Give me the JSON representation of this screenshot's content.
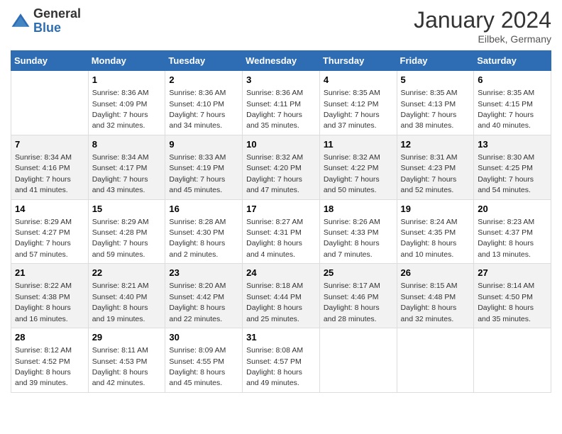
{
  "header": {
    "logo": {
      "general": "General",
      "blue": "Blue"
    },
    "title": "January 2024",
    "location": "Eilbek, Germany"
  },
  "days_header": [
    "Sunday",
    "Monday",
    "Tuesday",
    "Wednesday",
    "Thursday",
    "Friday",
    "Saturday"
  ],
  "weeks": [
    [
      {
        "day": "",
        "sunrise": "",
        "sunset": "",
        "daylight": ""
      },
      {
        "day": "1",
        "sunrise": "Sunrise: 8:36 AM",
        "sunset": "Sunset: 4:09 PM",
        "daylight": "Daylight: 7 hours and 32 minutes."
      },
      {
        "day": "2",
        "sunrise": "Sunrise: 8:36 AM",
        "sunset": "Sunset: 4:10 PM",
        "daylight": "Daylight: 7 hours and 34 minutes."
      },
      {
        "day": "3",
        "sunrise": "Sunrise: 8:36 AM",
        "sunset": "Sunset: 4:11 PM",
        "daylight": "Daylight: 7 hours and 35 minutes."
      },
      {
        "day": "4",
        "sunrise": "Sunrise: 8:35 AM",
        "sunset": "Sunset: 4:12 PM",
        "daylight": "Daylight: 7 hours and 37 minutes."
      },
      {
        "day": "5",
        "sunrise": "Sunrise: 8:35 AM",
        "sunset": "Sunset: 4:13 PM",
        "daylight": "Daylight: 7 hours and 38 minutes."
      },
      {
        "day": "6",
        "sunrise": "Sunrise: 8:35 AM",
        "sunset": "Sunset: 4:15 PM",
        "daylight": "Daylight: 7 hours and 40 minutes."
      }
    ],
    [
      {
        "day": "7",
        "sunrise": "Sunrise: 8:34 AM",
        "sunset": "Sunset: 4:16 PM",
        "daylight": "Daylight: 7 hours and 41 minutes."
      },
      {
        "day": "8",
        "sunrise": "Sunrise: 8:34 AM",
        "sunset": "Sunset: 4:17 PM",
        "daylight": "Daylight: 7 hours and 43 minutes."
      },
      {
        "day": "9",
        "sunrise": "Sunrise: 8:33 AM",
        "sunset": "Sunset: 4:19 PM",
        "daylight": "Daylight: 7 hours and 45 minutes."
      },
      {
        "day": "10",
        "sunrise": "Sunrise: 8:32 AM",
        "sunset": "Sunset: 4:20 PM",
        "daylight": "Daylight: 7 hours and 47 minutes."
      },
      {
        "day": "11",
        "sunrise": "Sunrise: 8:32 AM",
        "sunset": "Sunset: 4:22 PM",
        "daylight": "Daylight: 7 hours and 50 minutes."
      },
      {
        "day": "12",
        "sunrise": "Sunrise: 8:31 AM",
        "sunset": "Sunset: 4:23 PM",
        "daylight": "Daylight: 7 hours and 52 minutes."
      },
      {
        "day": "13",
        "sunrise": "Sunrise: 8:30 AM",
        "sunset": "Sunset: 4:25 PM",
        "daylight": "Daylight: 7 hours and 54 minutes."
      }
    ],
    [
      {
        "day": "14",
        "sunrise": "Sunrise: 8:29 AM",
        "sunset": "Sunset: 4:27 PM",
        "daylight": "Daylight: 7 hours and 57 minutes."
      },
      {
        "day": "15",
        "sunrise": "Sunrise: 8:29 AM",
        "sunset": "Sunset: 4:28 PM",
        "daylight": "Daylight: 7 hours and 59 minutes."
      },
      {
        "day": "16",
        "sunrise": "Sunrise: 8:28 AM",
        "sunset": "Sunset: 4:30 PM",
        "daylight": "Daylight: 8 hours and 2 minutes."
      },
      {
        "day": "17",
        "sunrise": "Sunrise: 8:27 AM",
        "sunset": "Sunset: 4:31 PM",
        "daylight": "Daylight: 8 hours and 4 minutes."
      },
      {
        "day": "18",
        "sunrise": "Sunrise: 8:26 AM",
        "sunset": "Sunset: 4:33 PM",
        "daylight": "Daylight: 8 hours and 7 minutes."
      },
      {
        "day": "19",
        "sunrise": "Sunrise: 8:24 AM",
        "sunset": "Sunset: 4:35 PM",
        "daylight": "Daylight: 8 hours and 10 minutes."
      },
      {
        "day": "20",
        "sunrise": "Sunrise: 8:23 AM",
        "sunset": "Sunset: 4:37 PM",
        "daylight": "Daylight: 8 hours and 13 minutes."
      }
    ],
    [
      {
        "day": "21",
        "sunrise": "Sunrise: 8:22 AM",
        "sunset": "Sunset: 4:38 PM",
        "daylight": "Daylight: 8 hours and 16 minutes."
      },
      {
        "day": "22",
        "sunrise": "Sunrise: 8:21 AM",
        "sunset": "Sunset: 4:40 PM",
        "daylight": "Daylight: 8 hours and 19 minutes."
      },
      {
        "day": "23",
        "sunrise": "Sunrise: 8:20 AM",
        "sunset": "Sunset: 4:42 PM",
        "daylight": "Daylight: 8 hours and 22 minutes."
      },
      {
        "day": "24",
        "sunrise": "Sunrise: 8:18 AM",
        "sunset": "Sunset: 4:44 PM",
        "daylight": "Daylight: 8 hours and 25 minutes."
      },
      {
        "day": "25",
        "sunrise": "Sunrise: 8:17 AM",
        "sunset": "Sunset: 4:46 PM",
        "daylight": "Daylight: 8 hours and 28 minutes."
      },
      {
        "day": "26",
        "sunrise": "Sunrise: 8:15 AM",
        "sunset": "Sunset: 4:48 PM",
        "daylight": "Daylight: 8 hours and 32 minutes."
      },
      {
        "day": "27",
        "sunrise": "Sunrise: 8:14 AM",
        "sunset": "Sunset: 4:50 PM",
        "daylight": "Daylight: 8 hours and 35 minutes."
      }
    ],
    [
      {
        "day": "28",
        "sunrise": "Sunrise: 8:12 AM",
        "sunset": "Sunset: 4:52 PM",
        "daylight": "Daylight: 8 hours and 39 minutes."
      },
      {
        "day": "29",
        "sunrise": "Sunrise: 8:11 AM",
        "sunset": "Sunset: 4:53 PM",
        "daylight": "Daylight: 8 hours and 42 minutes."
      },
      {
        "day": "30",
        "sunrise": "Sunrise: 8:09 AM",
        "sunset": "Sunset: 4:55 PM",
        "daylight": "Daylight: 8 hours and 45 minutes."
      },
      {
        "day": "31",
        "sunrise": "Sunrise: 8:08 AM",
        "sunset": "Sunset: 4:57 PM",
        "daylight": "Daylight: 8 hours and 49 minutes."
      },
      {
        "day": "",
        "sunrise": "",
        "sunset": "",
        "daylight": ""
      },
      {
        "day": "",
        "sunrise": "",
        "sunset": "",
        "daylight": ""
      },
      {
        "day": "",
        "sunrise": "",
        "sunset": "",
        "daylight": ""
      }
    ]
  ]
}
